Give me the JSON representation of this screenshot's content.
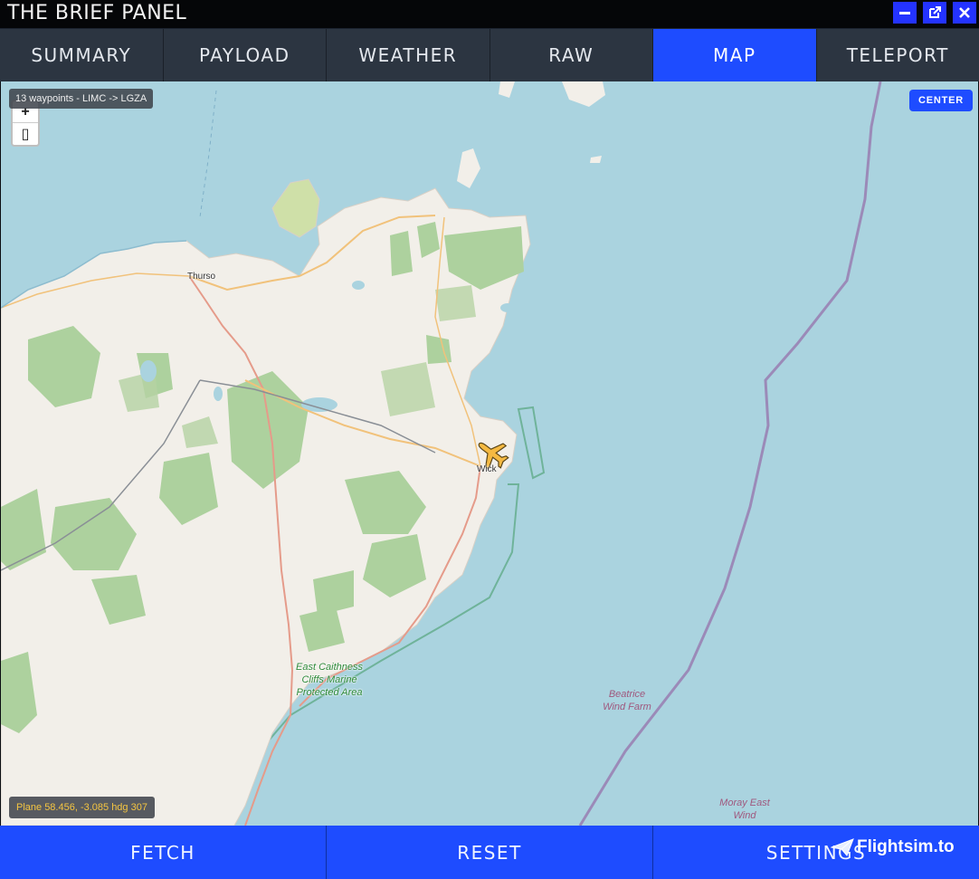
{
  "window": {
    "title": "THE BRIEF PANEL",
    "controls": [
      "minimize-icon",
      "popout-icon",
      "close-icon"
    ]
  },
  "tabs": [
    {
      "label": "SUMMARY",
      "active": false
    },
    {
      "label": "PAYLOAD",
      "active": false
    },
    {
      "label": "WEATHER",
      "active": false
    },
    {
      "label": "RAW",
      "active": false
    },
    {
      "label": "MAP",
      "active": true
    },
    {
      "label": "TELEPORT",
      "active": false
    }
  ],
  "map": {
    "waypoints_label": "13 waypoints - LIMC -> LGZA",
    "zoom_in": "+",
    "zoom_out": "▯",
    "center_button": "CENTER",
    "plane_info": "Plane 58.456, -3.085 hdg 307",
    "places": {
      "thurso": "Thurso",
      "wick": "Wick",
      "east_caithness": "East Caithness Cliffs Marine Protected Area",
      "beatrice": "Beatrice Wind Farm",
      "moray": "Moray East Wind"
    }
  },
  "bottom_bar": {
    "fetch": "FETCH",
    "reset": "RESET",
    "settings": "SETTINGS"
  },
  "watermark": "Flightsim.to",
  "colors": {
    "accent": "#1e4cff",
    "tab_bg": "#2c3541",
    "water": "#aad3df",
    "land": "#f2efe9",
    "forest": "#add19e",
    "plane": "#f4b942"
  }
}
